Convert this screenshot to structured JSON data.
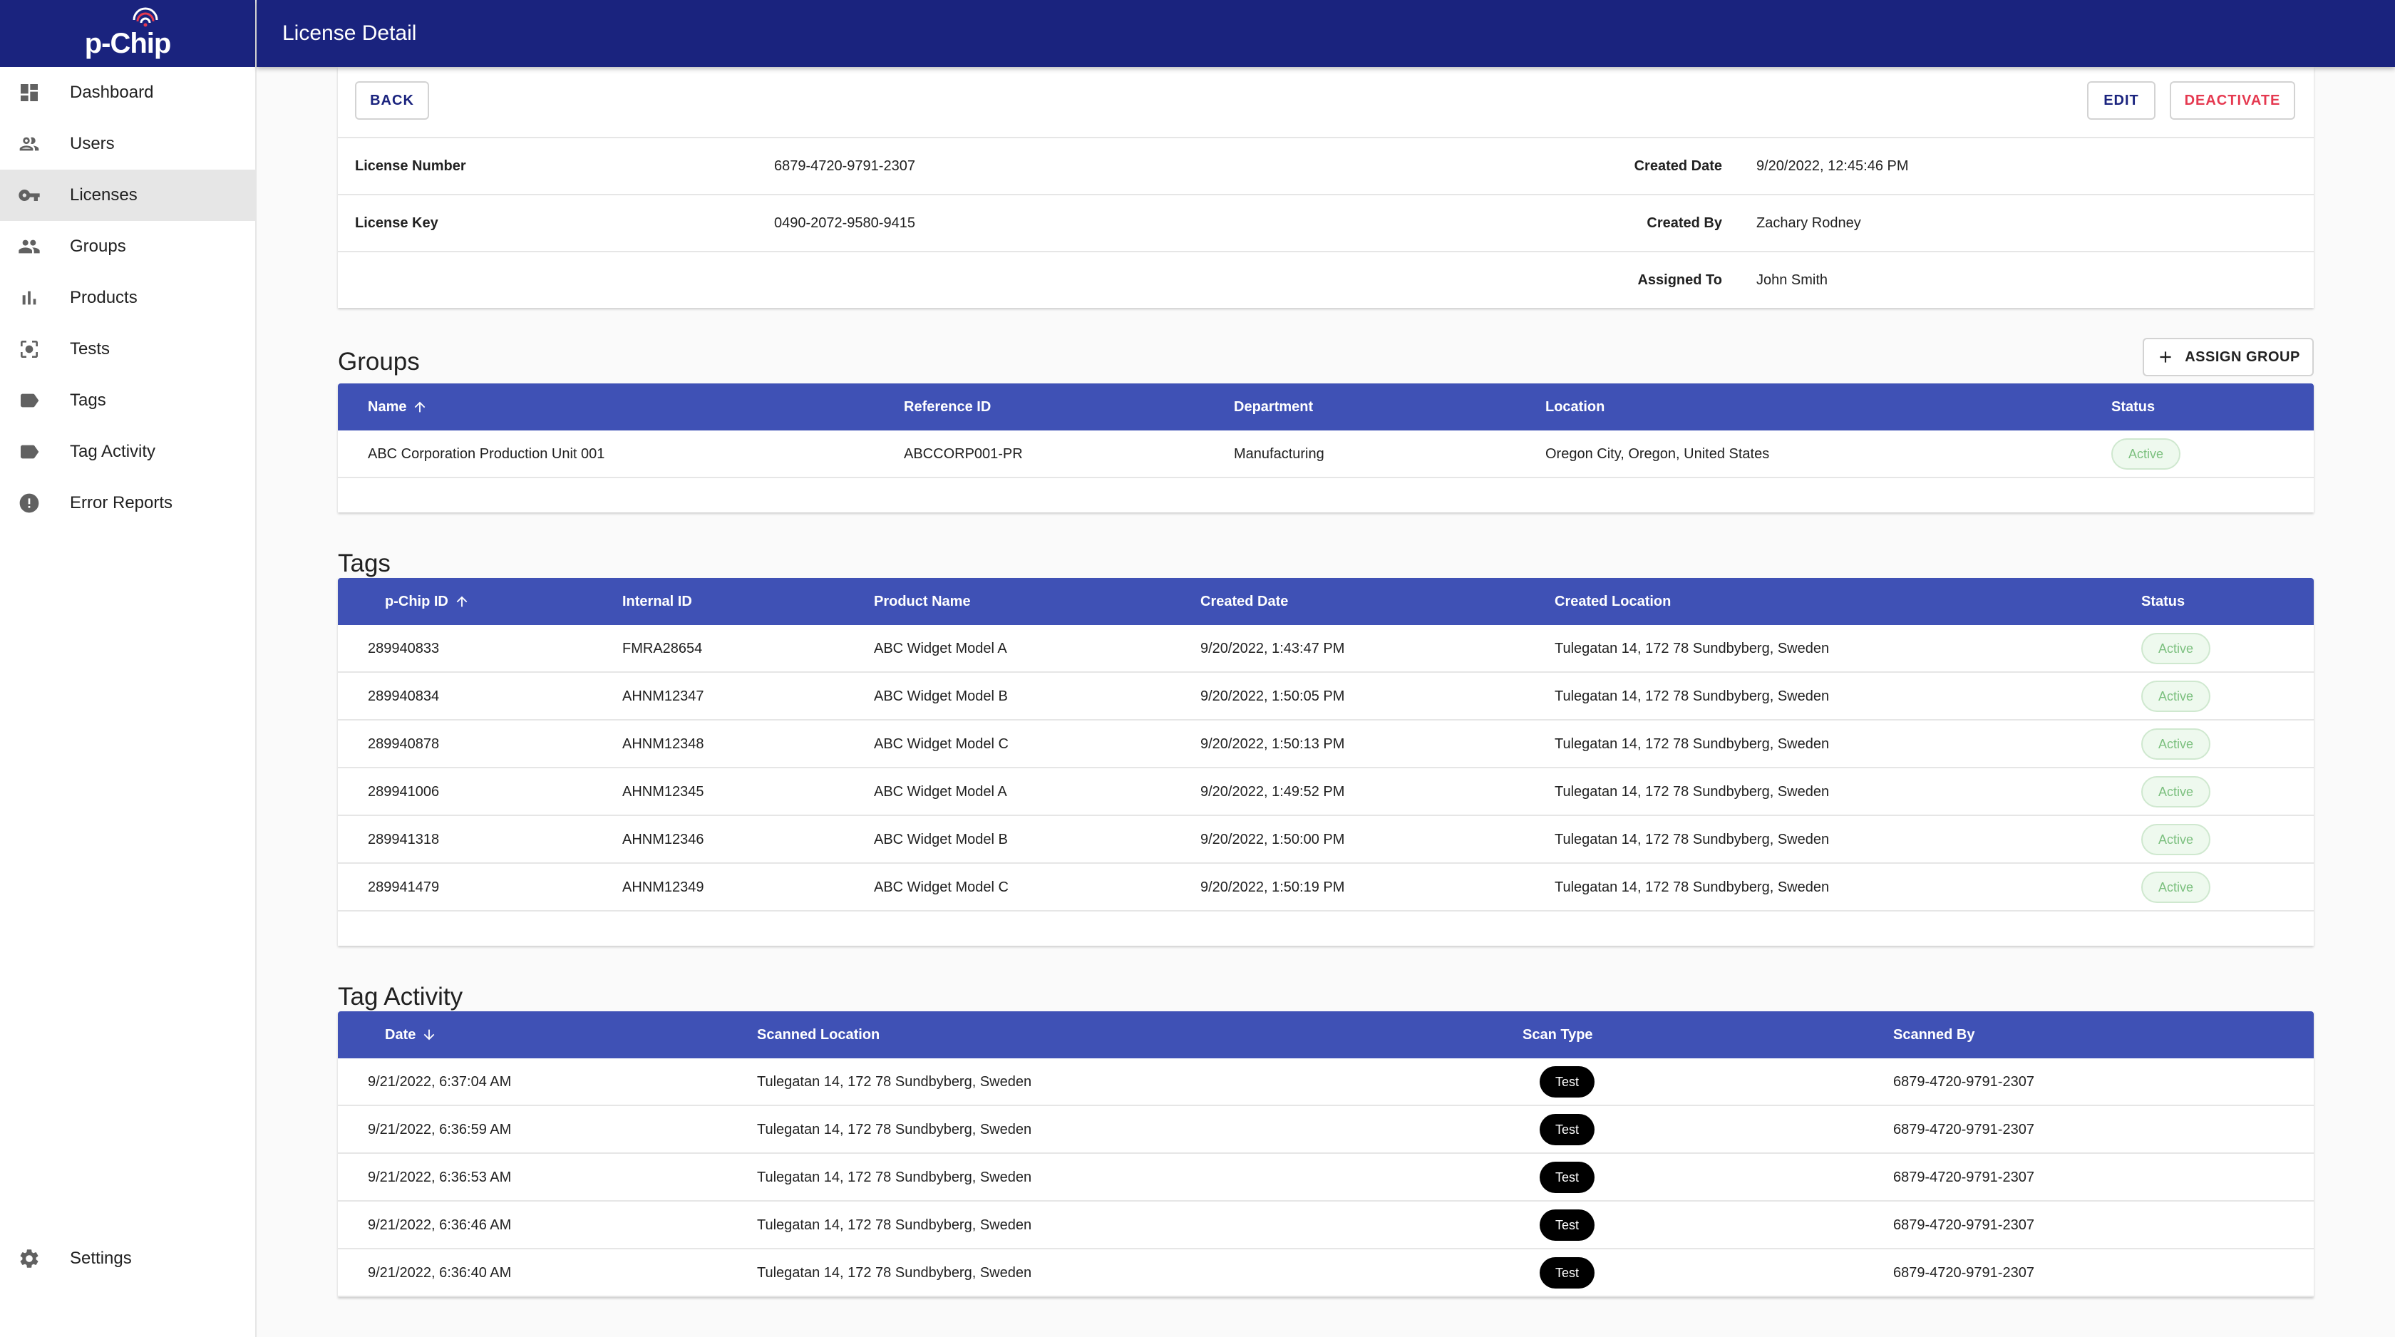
{
  "app": {
    "logo_text": "p-Chip"
  },
  "page": {
    "title": "License Detail"
  },
  "sidebar": {
    "items": [
      {
        "label": "Dashboard",
        "icon": "dashboard-icon"
      },
      {
        "label": "Users",
        "icon": "users-icon"
      },
      {
        "label": "Licenses",
        "icon": "key-icon",
        "active": true
      },
      {
        "label": "Groups",
        "icon": "groups-icon"
      },
      {
        "label": "Products",
        "icon": "bar-chart-icon"
      },
      {
        "label": "Tests",
        "icon": "scan-icon"
      },
      {
        "label": "Tags",
        "icon": "tag-icon"
      },
      {
        "label": "Tag Activity",
        "icon": "tag-activity-icon"
      },
      {
        "label": "Error Reports",
        "icon": "error-icon"
      }
    ],
    "settings": {
      "label": "Settings",
      "icon": "gear-icon"
    }
  },
  "actions": {
    "back": "BACK",
    "edit": "EDIT",
    "deactivate": "DEACTIVATE"
  },
  "license": {
    "license_number_label": "License Number",
    "license_number": "6879-4720-9791-2307",
    "license_key_label": "License Key",
    "license_key": "0490-2072-9580-9415",
    "created_date_label": "Created Date",
    "created_date": "9/20/2022, 12:45:46 PM",
    "created_by_label": "Created By",
    "created_by": "Zachary Rodney",
    "assigned_to_label": "Assigned To",
    "assigned_to": "John Smith"
  },
  "groups": {
    "title": "Groups",
    "assign_button": "ASSIGN GROUP",
    "columns": [
      "Name",
      "Reference ID",
      "Department",
      "Location",
      "Status"
    ],
    "rows": [
      [
        "ABC Corporation Production Unit 001",
        "ABCCORP001-PR",
        "Manufacturing",
        "Oregon City, Oregon, United States",
        "Active"
      ]
    ]
  },
  "tags": {
    "title": "Tags",
    "columns": [
      "p-Chip ID",
      "Internal ID",
      "Product Name",
      "Created Date",
      "Created Location",
      "Status"
    ],
    "rows": [
      [
        "289940833",
        "FMRA28654",
        "ABC Widget Model A",
        "9/20/2022, 1:43:47 PM",
        "Tulegatan 14, 172 78 Sundbyberg, Sweden",
        "Active"
      ],
      [
        "289940834",
        "AHNM12347",
        "ABC Widget Model B",
        "9/20/2022, 1:50:05 PM",
        "Tulegatan 14, 172 78 Sundbyberg, Sweden",
        "Active"
      ],
      [
        "289940878",
        "AHNM12348",
        "ABC Widget Model C",
        "9/20/2022, 1:50:13 PM",
        "Tulegatan 14, 172 78 Sundbyberg, Sweden",
        "Active"
      ],
      [
        "289941006",
        "AHNM12345",
        "ABC Widget Model A",
        "9/20/2022, 1:49:52 PM",
        "Tulegatan 14, 172 78 Sundbyberg, Sweden",
        "Active"
      ],
      [
        "289941318",
        "AHNM12346",
        "ABC Widget Model B",
        "9/20/2022, 1:50:00 PM",
        "Tulegatan 14, 172 78 Sundbyberg, Sweden",
        "Active"
      ],
      [
        "289941479",
        "AHNM12349",
        "ABC Widget Model C",
        "9/20/2022, 1:50:19 PM",
        "Tulegatan 14, 172 78 Sundbyberg, Sweden",
        "Active"
      ]
    ]
  },
  "tag_activity": {
    "title": "Tag Activity",
    "columns": [
      "Date",
      "Scanned Location",
      "Scan Type",
      "Scanned By"
    ],
    "rows": [
      [
        "9/21/2022, 6:37:04 AM",
        "Tulegatan 14, 172 78 Sundbyberg, Sweden",
        "Test",
        "6879-4720-9791-2307"
      ],
      [
        "9/21/2022, 6:36:59 AM",
        "Tulegatan 14, 172 78 Sundbyberg, Sweden",
        "Test",
        "6879-4720-9791-2307"
      ],
      [
        "9/21/2022, 6:36:53 AM",
        "Tulegatan 14, 172 78 Sundbyberg, Sweden",
        "Test",
        "6879-4720-9791-2307"
      ],
      [
        "9/21/2022, 6:36:46 AM",
        "Tulegatan 14, 172 78 Sundbyberg, Sweden",
        "Test",
        "6879-4720-9791-2307"
      ],
      [
        "9/21/2022, 6:36:40 AM",
        "Tulegatan 14, 172 78 Sundbyberg, Sweden",
        "Test",
        "6879-4720-9791-2307"
      ]
    ]
  },
  "colors": {
    "header_bg": "#1a237e",
    "table_header_bg": "#3f51b5",
    "deactivate": "#e53950",
    "active_chip_text": "#7cc07f"
  }
}
